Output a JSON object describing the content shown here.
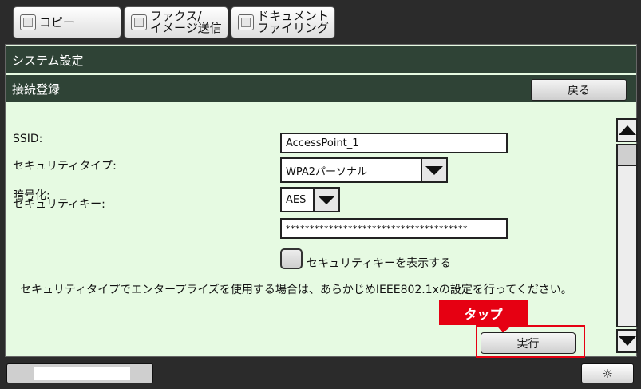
{
  "tabs": [
    {
      "label": "コピー",
      "icon": "copy-icon"
    },
    {
      "label_line1": "ファクス/",
      "label_line2": "イメージ送信",
      "icon": "fax-icon"
    },
    {
      "label_line1": "ドキュメント",
      "label_line2": "ファイリング",
      "icon": "document-filing-icon"
    }
  ],
  "header": {
    "system_title": "システム設定",
    "connect_title": "接続登録",
    "back_label": "戻る"
  },
  "form": {
    "ssid_label": "SSID:",
    "ssid_value": "AccessPoint_1",
    "security_type_label": "セキュリティタイプ:",
    "security_type_value": "WPA2パーソナル",
    "encryption_label": "暗号化:",
    "encryption_value": "AES",
    "security_key_label": "セキュリティキー:",
    "security_key_value": "**************************************",
    "show_key_label": "セキュリティキーを表示する",
    "note": "セキュリティタイプでエンタープライズを使用する場合は、あらかじめIEEE802.1xの設定を行ってください。"
  },
  "annotation": {
    "tap_label": "タップ"
  },
  "actions": {
    "execute_label": "実行"
  },
  "footer": {
    "brightness_icon": "☼"
  },
  "colors": {
    "header_bar": "#2f4336",
    "panel_bg": "#e6fae2",
    "highlight": "#e60012"
  }
}
